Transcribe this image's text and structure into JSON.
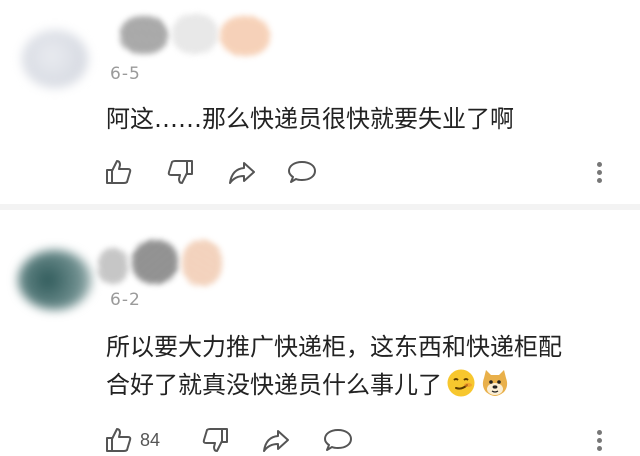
{
  "comments": [
    {
      "date": "6-5",
      "lines": [
        "阿这……那么快递员很快就要失业了啊"
      ],
      "likes": "",
      "icons": [
        "thumb-up-icon",
        "thumb-down-icon",
        "share-icon",
        "reply-icon",
        "more-icon"
      ]
    },
    {
      "date": "6-2",
      "lines": [
        "所以要大力推广快递柜，这东西和快递柜配",
        "合好了就真没快递员什么事儿了"
      ],
      "likes": "84",
      "emojis": [
        "smirk-emoji-icon",
        "doge-emoji-icon"
      ],
      "icons": [
        "thumb-up-icon",
        "thumb-down-icon",
        "share-icon",
        "reply-icon",
        "more-icon"
      ]
    }
  ],
  "colors": {
    "text": "#222222",
    "meta": "#9a9a9a",
    "icon": "#555555",
    "divider": "#f3f3f3"
  }
}
